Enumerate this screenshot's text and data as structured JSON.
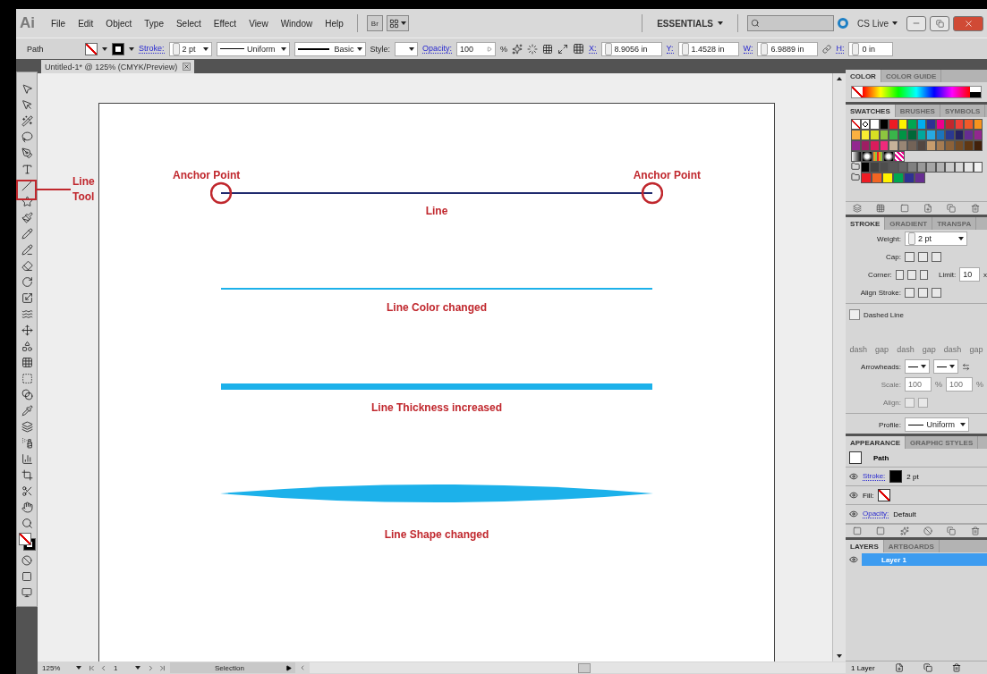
{
  "menu_bar": {
    "logo": "Ai",
    "menus": [
      "File",
      "Edit",
      "Object",
      "Type",
      "Select",
      "Effect",
      "View",
      "Window",
      "Help"
    ],
    "bridge": "Br",
    "workspace": "ESSENTIALS",
    "cs_live": "CS Live"
  },
  "control_bar": {
    "selection": "Path",
    "stroke_label": "Stroke:",
    "stroke_weight": "2 pt",
    "variable_width": "Uniform",
    "brush": "Basic",
    "style_label": "Style:",
    "opacity_label": "Opacity:",
    "opacity": "100",
    "opacity_unit": "%",
    "transform": [
      {
        "label": "X:",
        "value": "8.9056 in"
      },
      {
        "label": "Y:",
        "value": "1.4528 in"
      },
      {
        "label": "W:",
        "value": "6.9889 in"
      },
      {
        "label": "H:",
        "value": "0 in"
      }
    ]
  },
  "document": {
    "tab_title": "Untitled-1* @ 125% (CMYK/Preview)"
  },
  "callout": {
    "label": "Line Tool"
  },
  "artboard": {
    "samples": [
      {
        "kind": "anchored",
        "color": "#1f2a6e",
        "caption": "Line",
        "anchor_labels": [
          "Anchor Point",
          "Anchor Point"
        ]
      },
      {
        "kind": "thin",
        "color": "#1cb1ea",
        "caption": "Line Color changed"
      },
      {
        "kind": "thick",
        "color": "#1cb1ea",
        "caption": "Line Thickness increased"
      },
      {
        "kind": "tapered",
        "color": "#1cb1ea",
        "caption": "Line Shape changed"
      }
    ]
  },
  "panels": {
    "color": {
      "tabs": [
        {
          "label": "COLOR",
          "selected": true
        },
        {
          "label": "COLOR GUIDE",
          "selected": false
        }
      ]
    },
    "swatches": {
      "tabs": [
        {
          "label": "SWATCHES",
          "selected": true
        },
        {
          "label": "BRUSHES",
          "selected": false
        },
        {
          "label": "SYMBOLS",
          "selected": false
        }
      ],
      "rows": [
        {
          "group": false,
          "swatches": [
            {
              "kind": "none"
            },
            {
              "kind": "registration"
            },
            {
              "kind": "solid",
              "color": "#ffffff"
            },
            {
              "kind": "solid",
              "color": "#000000"
            },
            {
              "kind": "solid",
              "color": "#ed1c24"
            },
            {
              "kind": "solid",
              "color": "#fff200"
            },
            {
              "kind": "solid",
              "color": "#00a651"
            },
            {
              "kind": "solid",
              "color": "#00aeef"
            },
            {
              "kind": "solid",
              "color": "#2e3192"
            },
            {
              "kind": "solid",
              "color": "#ec008c"
            },
            {
              "kind": "solid",
              "color": "#c1272d"
            },
            {
              "kind": "solid",
              "color": "#ef4136"
            },
            {
              "kind": "solid",
              "color": "#f15a29"
            },
            {
              "kind": "solid",
              "color": "#f7941d"
            }
          ]
        },
        {
          "group": false,
          "swatches": [
            {
              "kind": "solid",
              "color": "#fbb040"
            },
            {
              "kind": "solid",
              "color": "#f9ed32"
            },
            {
              "kind": "solid",
              "color": "#d7df23"
            },
            {
              "kind": "solid",
              "color": "#8dc63f"
            },
            {
              "kind": "solid",
              "color": "#39b54a"
            },
            {
              "kind": "solid",
              "color": "#009444"
            },
            {
              "kind": "solid",
              "color": "#006838"
            },
            {
              "kind": "solid",
              "color": "#00a79d"
            },
            {
              "kind": "solid",
              "color": "#27aae1"
            },
            {
              "kind": "solid",
              "color": "#1c75bc"
            },
            {
              "kind": "solid",
              "color": "#2b3990"
            },
            {
              "kind": "solid",
              "color": "#262262"
            },
            {
              "kind": "solid",
              "color": "#662d91"
            },
            {
              "kind": "solid",
              "color": "#92278f"
            }
          ]
        },
        {
          "group": false,
          "swatches": [
            {
              "kind": "solid",
              "color": "#92278f"
            },
            {
              "kind": "solid",
              "color": "#9e1f63"
            },
            {
              "kind": "solid",
              "color": "#da1c5c"
            },
            {
              "kind": "solid",
              "color": "#ee2a7b"
            },
            {
              "kind": "solid",
              "color": "#c7b299"
            },
            {
              "kind": "solid",
              "color": "#998675"
            },
            {
              "kind": "solid",
              "color": "#736357"
            },
            {
              "kind": "solid",
              "color": "#534741"
            },
            {
              "kind": "solid",
              "color": "#c69c6d"
            },
            {
              "kind": "solid",
              "color": "#a67c52"
            },
            {
              "kind": "solid",
              "color": "#8c6239"
            },
            {
              "kind": "solid",
              "color": "#754c24"
            },
            {
              "kind": "solid",
              "color": "#603813"
            },
            {
              "kind": "solid",
              "color": "#42210b"
            }
          ]
        },
        {
          "group": false,
          "swatches": [
            {
              "kind": "gradient"
            },
            {
              "kind": "radial"
            },
            {
              "kind": "stripes"
            },
            {
              "kind": "radial"
            },
            {
              "kind": "pattern"
            }
          ]
        },
        {
          "group": true,
          "swatches": [
            {
              "kind": "solid",
              "color": "#000000"
            },
            {
              "kind": "solid",
              "color": "#414141"
            },
            {
              "kind": "solid",
              "color": "#4d4d4d"
            },
            {
              "kind": "solid",
              "color": "#595959"
            },
            {
              "kind": "solid",
              "color": "#666666"
            },
            {
              "kind": "solid",
              "color": "#808080"
            },
            {
              "kind": "solid",
              "color": "#999999"
            },
            {
              "kind": "solid",
              "color": "#a6a6a6"
            },
            {
              "kind": "solid",
              "color": "#b3b3b3"
            },
            {
              "kind": "solid",
              "color": "#cccccc"
            },
            {
              "kind": "solid",
              "color": "#d9d9d9"
            },
            {
              "kind": "solid",
              "color": "#e6e6e6"
            },
            {
              "kind": "solid",
              "color": "#f2f2f2"
            }
          ]
        },
        {
          "group": true,
          "swatches": [
            {
              "kind": "solid",
              "color": "#ed1c24"
            },
            {
              "kind": "solid",
              "color": "#f26522"
            },
            {
              "kind": "solid",
              "color": "#fff200"
            },
            {
              "kind": "solid",
              "color": "#00a651"
            },
            {
              "kind": "solid",
              "color": "#2e3192"
            },
            {
              "kind": "solid",
              "color": "#662d91"
            }
          ]
        }
      ]
    },
    "stroke": {
      "tabs": [
        {
          "label": "STROKE",
          "selected": true
        },
        {
          "label": "GRADIENT",
          "selected": false
        },
        {
          "label": "TRANSPA",
          "selected": false
        }
      ],
      "weight_label": "Weight:",
      "weight": "2 pt",
      "cap_label": "Cap:",
      "corner_label": "Corner:",
      "limit_label": "Limit:",
      "limit": "10",
      "limit_unit": "x",
      "align_label": "Align Stroke:",
      "dashed": {
        "label": "Dashed Line",
        "checked": false
      },
      "dash_pattern": {
        "disabled": true,
        "labels": [
          "dash",
          "gap",
          "dash",
          "gap",
          "dash",
          "gap"
        ]
      },
      "arrowheads_label": "Arrowheads:",
      "scale": {
        "label": "Scale:",
        "disabled": true,
        "fields": [
          {
            "value": "100",
            "unit": "%"
          },
          {
            "value": "100",
            "unit": "%"
          }
        ]
      },
      "arrow_align": {
        "label": "Align:",
        "disabled": true
      },
      "profile_label": "Profile:",
      "profile": "Uniform"
    },
    "appearance": {
      "tabs": [
        {
          "label": "APPEARANCE",
          "selected": true
        },
        {
          "label": "GRAPHIC STYLES",
          "selected": false
        }
      ],
      "object": "Path",
      "rows": [
        {
          "kind": "stroke",
          "label": "Stroke:",
          "value": "2 pt"
        },
        {
          "kind": "fill",
          "label": "Fill:"
        },
        {
          "kind": "opacity",
          "label": "Opacity:",
          "value": "Default"
        }
      ]
    },
    "layers": {
      "tabs": [
        {
          "label": "LAYERS",
          "selected": true
        },
        {
          "label": "ARTBOARDS",
          "selected": false
        }
      ],
      "layers": [
        {
          "name": "Layer 1",
          "selected": true
        }
      ],
      "count": "1 Layer"
    }
  },
  "status_bar": {
    "zoom": "125%",
    "artboard": "1",
    "tool": "Selection"
  }
}
